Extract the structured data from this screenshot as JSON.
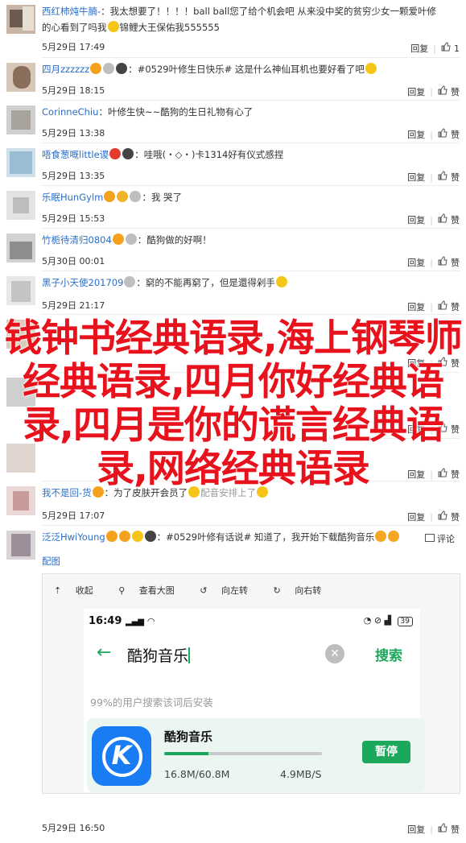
{
  "comments": [
    {
      "user": "西红柿炖牛腩-",
      "text": "我太想要了！！！！ball  ball您了给个机会吧 从来没中奖的贫穷少女一颗爱叶修",
      "text2": "的心看到了吗我",
      "text2b": "锦鲤大王保佑我555555",
      "time": "5月29日 17:49",
      "reply": "回复",
      "like": "1"
    },
    {
      "user": "四月zzzzzz",
      "text": "#0529叶修生日快乐# 这是什么神仙耳机也要好看了吧",
      "time": "5月29日 18:15",
      "reply": "回复",
      "like": "赞"
    },
    {
      "user": "CorinneChiu",
      "text": "叶修生快~~酷狗的生日礼物有心了",
      "time": "5月29日 13:38",
      "reply": "回复",
      "like": "赞"
    },
    {
      "user": "唔食葱嘅little谡",
      "text": "哇哦(・◇・)卡1314好有仪式感捏",
      "time": "5月29日 13:35",
      "reply": "回复",
      "like": "赞"
    },
    {
      "user": "乐眠HunGylm",
      "text": "我    哭了",
      "time": "5月29日 15:53",
      "reply": "回复",
      "like": "赞"
    },
    {
      "user": "竹栀待清归0804",
      "text": "酷狗做的好啊！",
      "time": "5月30日 00:01",
      "reply": "回复",
      "like": "赞"
    },
    {
      "user": "黑子小天使201709",
      "text": "窮的不能再窮了，但是還得剁手",
      "time": "5月29日 21:17",
      "reply": "回复",
      "like": "赞"
    },
    {
      "user": "",
      "text": "",
      "time": "",
      "reply": "回复",
      "like": "赞"
    },
    {
      "user": "",
      "text": "",
      "time": "",
      "reply": "回复",
      "like": "赞"
    },
    {
      "user": "",
      "text": "",
      "time": "",
      "reply": "回复",
      "like": "赞"
    },
    {
      "user": "我不是回-货",
      "text": "为了皮肤开会员了",
      "text_b": "配音安排上了",
      "time": "5月29日 17:07",
      "reply": "回复",
      "like": "赞"
    },
    {
      "user": "泛泛HwiYoung",
      "text": "#0529叶修有话说# 知道了，我开始下载酷狗音乐",
      "text2": "配图",
      "time": "5月29日 16:50",
      "reply": "回复",
      "like": "赞",
      "comment_label": "评论"
    }
  ],
  "overlay_title": "钱钟书经典语录,海上钢琴师经典语录,四月你好经典语录,四月是你的谎言经典语录,网络经典语录",
  "image_tools": [
    "收起",
    "查看大图",
    "向左转",
    "向右转"
  ],
  "phone": {
    "time": "16:49",
    "battery": "39",
    "search_value": "酷狗音乐",
    "search_button": "搜索",
    "hint": "99%的用户搜索该词后安装",
    "app_name": "酷狗音乐",
    "downloaded": "16.8M/60.8M",
    "speed": "4.9MB/S",
    "pause": "暂停",
    "progress": 0.28
  },
  "colors": {
    "accent": "#1ba85b",
    "link": "#2a6ec9",
    "overlay": "#e8121d",
    "app_icon": "#1a7cf2"
  }
}
